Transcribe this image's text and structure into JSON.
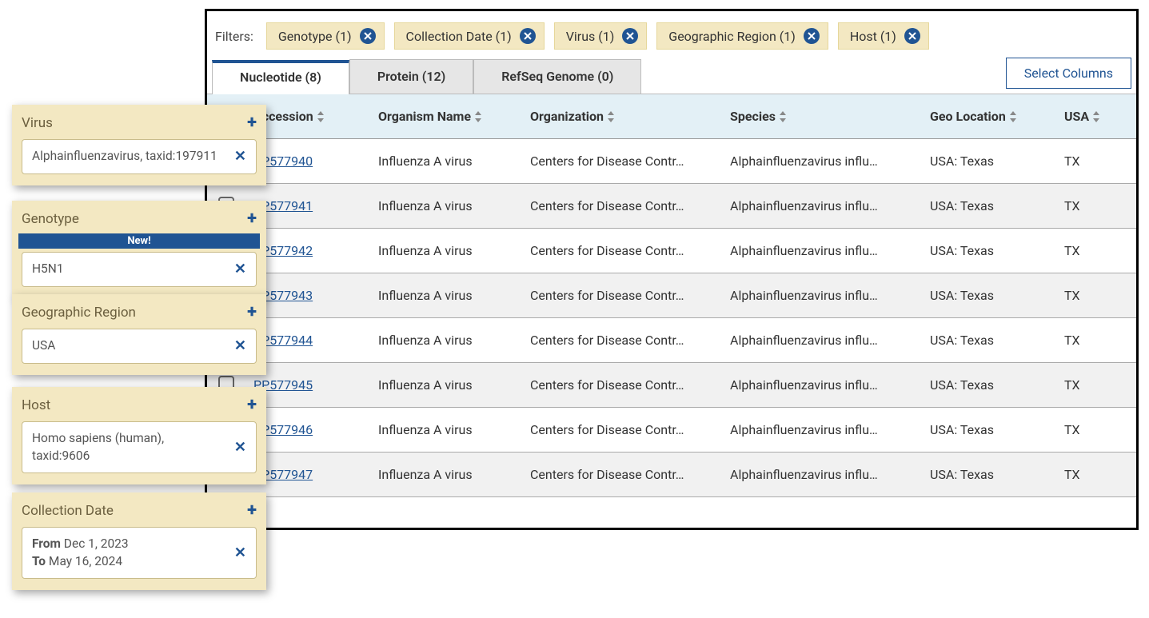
{
  "filters": {
    "label": "Filters:",
    "chips": [
      {
        "label": "Genotype (1)"
      },
      {
        "label": "Collection Date (1)"
      },
      {
        "label": "Virus (1)"
      },
      {
        "label": "Geographic Region (1)"
      },
      {
        "label": "Host (1)"
      }
    ]
  },
  "tabs": [
    {
      "label": "Nucleotide (8)",
      "active": true
    },
    {
      "label": "Protein (12)",
      "active": false
    },
    {
      "label": "RefSeq Genome (0)",
      "active": false
    }
  ],
  "select_columns_label": "Select Columns",
  "columns": {
    "accession": "Accession",
    "organism_name": "Organism Name",
    "organization": "Organization",
    "species": "Species",
    "geo_location": "Geo Location",
    "usa": "USA"
  },
  "rows": [
    {
      "accession": "PP577940",
      "organism": "Influenza A virus",
      "organization": "Centers for Disease Contr…",
      "species": "Alphainfluenzavirus influ…",
      "geo": "USA: Texas",
      "usa": "TX"
    },
    {
      "accession": "PP577941",
      "organism": "Influenza A virus",
      "organization": "Centers for Disease Contr…",
      "species": "Alphainfluenzavirus influ…",
      "geo": "USA: Texas",
      "usa": "TX"
    },
    {
      "accession": "PP577942",
      "organism": "Influenza A virus",
      "organization": "Centers for Disease Contr…",
      "species": "Alphainfluenzavirus influ…",
      "geo": "USA: Texas",
      "usa": "TX"
    },
    {
      "accession": "PP577943",
      "organism": "Influenza A virus",
      "organization": "Centers for Disease Contr…",
      "species": "Alphainfluenzavirus influ…",
      "geo": "USA: Texas",
      "usa": "TX"
    },
    {
      "accession": "PP577944",
      "organism": "Influenza A virus",
      "organization": "Centers for Disease Contr…",
      "species": "Alphainfluenzavirus influ…",
      "geo": "USA: Texas",
      "usa": "TX"
    },
    {
      "accession": "PP577945",
      "organism": "Influenza A virus",
      "organization": "Centers for Disease Contr…",
      "species": "Alphainfluenzavirus influ…",
      "geo": "USA: Texas",
      "usa": "TX"
    },
    {
      "accession": "PP577946",
      "organism": "Influenza A virus",
      "organization": "Centers for Disease Contr…",
      "species": "Alphainfluenzavirus influ…",
      "geo": "USA: Texas",
      "usa": "TX"
    },
    {
      "accession": "PP577947",
      "organism": "Influenza A virus",
      "organization": "Centers for Disease Contr…",
      "species": "Alphainfluenzavirus influ…",
      "geo": "USA: Texas",
      "usa": "TX"
    }
  ],
  "side_cards": {
    "virus": {
      "title": "Virus",
      "value": "Alphainfluenzavirus, taxid:197911"
    },
    "genotype": {
      "title": "Genotype",
      "badge": "New!",
      "value": "H5N1"
    },
    "geo": {
      "title": "Geographic Region",
      "value": "USA"
    },
    "host": {
      "title": "Host",
      "value": "Homo sapiens (human), taxid:9606"
    },
    "date": {
      "title": "Collection Date",
      "from_label": "From",
      "from": "Dec 1, 2023",
      "to_label": "To",
      "to": "May 16, 2024"
    }
  }
}
